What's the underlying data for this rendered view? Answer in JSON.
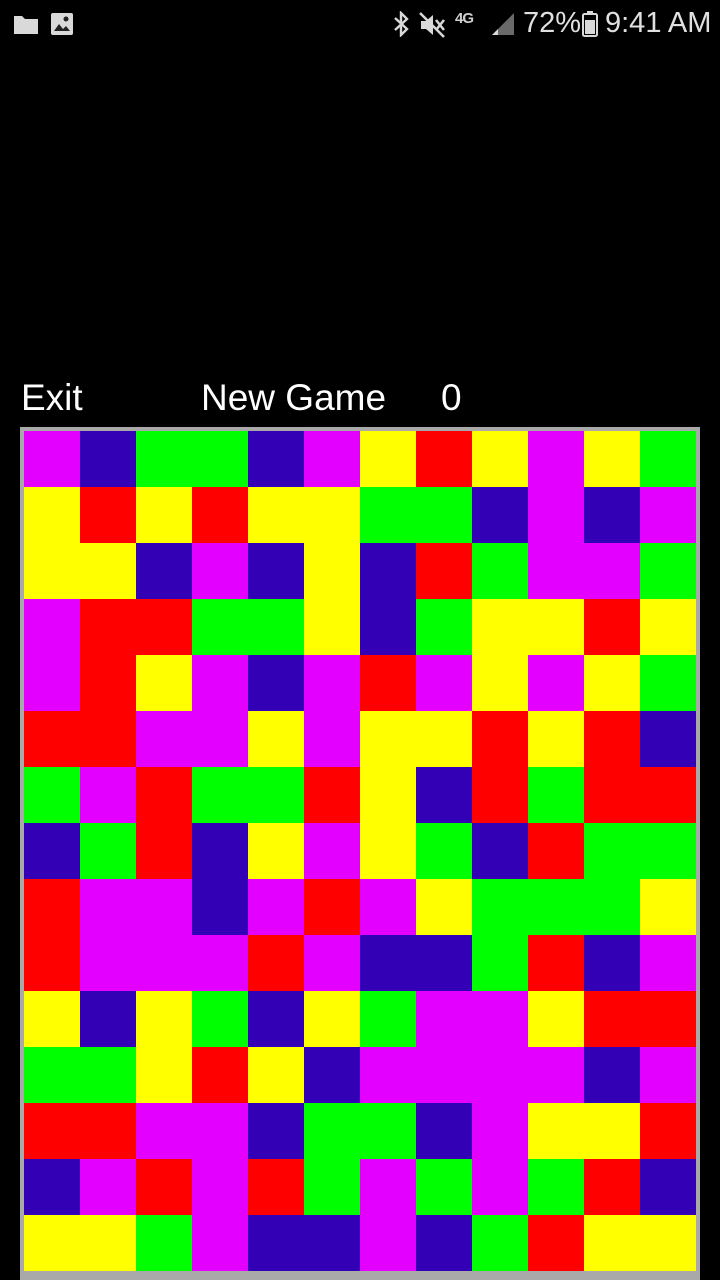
{
  "status_bar": {
    "battery_percent": "72%",
    "time": "9:41 AM",
    "network": "4G",
    "icons": [
      "folder-icon",
      "image-icon",
      "bluetooth-icon",
      "mute-icon",
      "network-4g-icon",
      "signal-icon",
      "battery-icon"
    ]
  },
  "header": {
    "exit_label": "Exit",
    "new_game_label": "New Game",
    "score": "0"
  },
  "palette": {
    "M": "#e400ff",
    "B": "#3300b5",
    "G": "#00ff00",
    "Y": "#ffff00",
    "R": "#ff0000"
  },
  "board": {
    "columns": 12,
    "rows": 15,
    "cells": [
      [
        "M",
        "B",
        "G",
        "G",
        "B",
        "M",
        "Y",
        "R",
        "Y",
        "M",
        "Y",
        "G"
      ],
      [
        "Y",
        "R",
        "Y",
        "R",
        "Y",
        "Y",
        "G",
        "G",
        "B",
        "M",
        "B",
        "M"
      ],
      [
        "Y",
        "Y",
        "B",
        "M",
        "B",
        "Y",
        "B",
        "R",
        "G",
        "M",
        "M",
        "G"
      ],
      [
        "M",
        "R",
        "R",
        "G",
        "G",
        "Y",
        "B",
        "G",
        "Y",
        "Y",
        "R",
        "Y"
      ],
      [
        "M",
        "R",
        "Y",
        "M",
        "B",
        "M",
        "R",
        "M",
        "Y",
        "M",
        "Y",
        "G"
      ],
      [
        "R",
        "R",
        "M",
        "M",
        "Y",
        "M",
        "Y",
        "Y",
        "R",
        "Y",
        "R",
        "B"
      ],
      [
        "G",
        "M",
        "R",
        "G",
        "G",
        "R",
        "Y",
        "B",
        "R",
        "G",
        "R",
        "R"
      ],
      [
        "B",
        "G",
        "R",
        "B",
        "Y",
        "M",
        "Y",
        "G",
        "B",
        "R",
        "G",
        "G"
      ],
      [
        "R",
        "M",
        "M",
        "B",
        "M",
        "R",
        "M",
        "Y",
        "G",
        "G",
        "G",
        "Y"
      ],
      [
        "R",
        "M",
        "M",
        "M",
        "R",
        "M",
        "B",
        "B",
        "G",
        "R",
        "B",
        "M"
      ],
      [
        "Y",
        "B",
        "Y",
        "G",
        "B",
        "Y",
        "G",
        "M",
        "M",
        "Y",
        "R",
        "R"
      ],
      [
        "G",
        "G",
        "Y",
        "R",
        "Y",
        "B",
        "M",
        "M",
        "M",
        "M",
        "B",
        "M"
      ],
      [
        "R",
        "R",
        "M",
        "M",
        "B",
        "G",
        "G",
        "B",
        "M",
        "Y",
        "Y",
        "R"
      ],
      [
        "B",
        "M",
        "R",
        "M",
        "R",
        "G",
        "M",
        "G",
        "M",
        "G",
        "R",
        "B"
      ],
      [
        "Y",
        "Y",
        "G",
        "M",
        "B",
        "B",
        "M",
        "B",
        "G",
        "R",
        "Y",
        "Y"
      ]
    ]
  }
}
